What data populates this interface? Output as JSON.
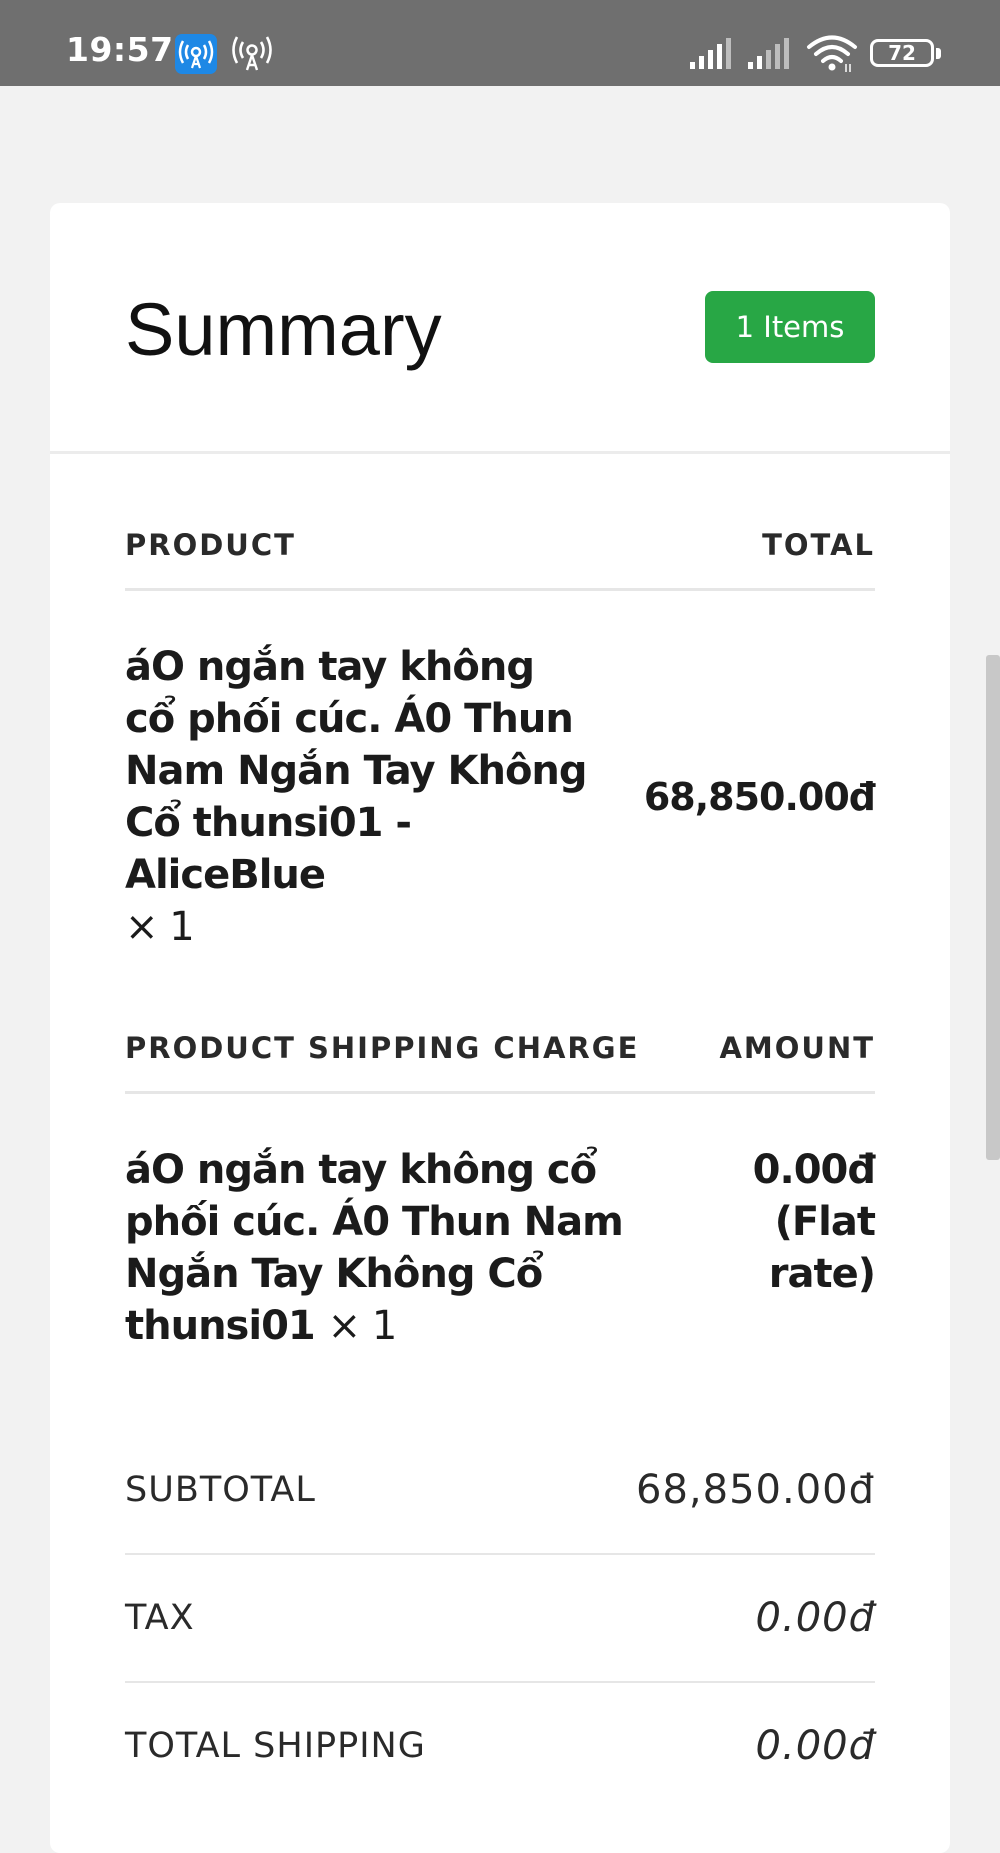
{
  "status_bar": {
    "time": "19:57",
    "battery_level": "72",
    "icons": [
      "hotspot-icon",
      "hotspot-icon",
      "signal-icon",
      "signal-icon",
      "wifi-icon",
      "battery-icon"
    ]
  },
  "summary": {
    "title": "Summary",
    "items_badge": "1 Items",
    "badge_color": "#28a745"
  },
  "products": {
    "header_left": "PRODUCT",
    "header_right": "TOTAL",
    "rows": [
      {
        "name": "áO ngắn tay không cổ phối cúc. Á0 Thun Nam Ngắn Tay Không Cổ thunsi01 - AliceBlue",
        "qty": "× 1",
        "total": "68,850.00đ"
      }
    ]
  },
  "shipping": {
    "header_left": "PRODUCT SHIPPING CHARGE",
    "header_right": "AMOUNT",
    "rows": [
      {
        "name": "áO ngắn tay không cổ phối cúc. Á0 Thun Nam Ngắn Tay Không Cổ thunsi01",
        "qty": "× 1",
        "amount": "0.00đ (Flat rate)"
      }
    ]
  },
  "totals": {
    "subtotal_label": "SUBTOTAL",
    "subtotal_value": "68,850.00đ",
    "tax_label": "TAX",
    "tax_value": "0.00đ",
    "shipping_label": "TOTAL SHIPPING",
    "shipping_value": "0.00đ"
  }
}
